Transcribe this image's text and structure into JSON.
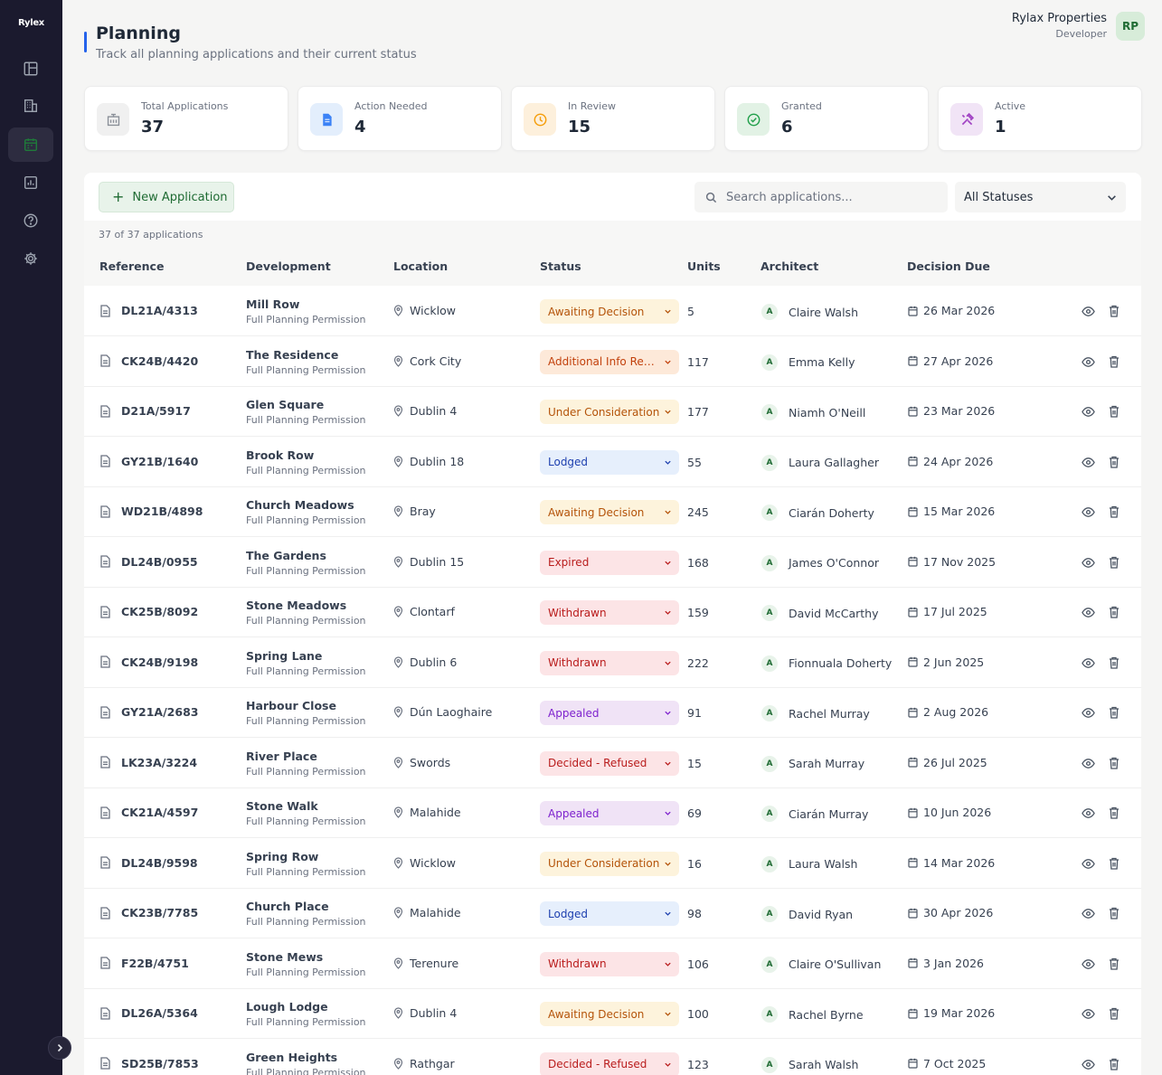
{
  "app": {
    "logo": "Rylex"
  },
  "header": {
    "title": "Planning",
    "subtitle": "Track all planning applications and their current status"
  },
  "user": {
    "name": "Rylax Properties",
    "role": "Developer",
    "initials": "RP"
  },
  "stats": [
    {
      "label": "Total Applications",
      "value": "37",
      "icon": "building-icon",
      "bg": "#f0f0f0",
      "color": "#8a8f98"
    },
    {
      "label": "Action Needed",
      "value": "4",
      "icon": "document-icon",
      "bg": "#e3eefc",
      "color": "#3b82f6"
    },
    {
      "label": "In Review",
      "value": "15",
      "icon": "clock-icon",
      "bg": "#fdf0dc",
      "color": "#f59e0b"
    },
    {
      "label": "Granted",
      "value": "6",
      "icon": "check-circle-icon",
      "bg": "#e2f2e5",
      "color": "#22a04b"
    },
    {
      "label": "Active",
      "value": "1",
      "icon": "tools-icon",
      "bg": "#f1e4f6",
      "color": "#a245c4"
    }
  ],
  "toolbar": {
    "new_label": "New Application",
    "search_placeholder": "Search applications...",
    "status_filter": "All Statuses",
    "count_text": "37 of 37 applications"
  },
  "columns": [
    "Reference",
    "Development",
    "Location",
    "Status",
    "Units",
    "Architect",
    "Decision Due"
  ],
  "status_colors": {
    "Awaiting Decision": {
      "bg": "#fdf3dc",
      "fg": "#b45309"
    },
    "Additional Info Req...": {
      "bg": "#fde9d9",
      "fg": "#c2410c"
    },
    "Under Consideration": {
      "bg": "#fdf3dc",
      "fg": "#b45309"
    },
    "Lodged": {
      "bg": "#e6effc",
      "fg": "#1e40af"
    },
    "Expired": {
      "bg": "#fce4e6",
      "fg": "#b91c1c"
    },
    "Withdrawn": {
      "bg": "#fce4e6",
      "fg": "#b91c1c"
    },
    "Appealed": {
      "bg": "#f0e3f6",
      "fg": "#7e22ce"
    },
    "Decided - Refused": {
      "bg": "#fce4e6",
      "fg": "#b91c1c"
    }
  },
  "rows": [
    {
      "ref": "DL21A/4313",
      "dev": "Mill Row",
      "type": "Full Planning Permission",
      "loc": "Wicklow",
      "status": "Awaiting Decision",
      "units": "5",
      "arch_initial": "A",
      "arch": "Claire Walsh",
      "due": "26 Mar 2026"
    },
    {
      "ref": "CK24B/4420",
      "dev": "The Residence",
      "type": "Full Planning Permission",
      "loc": "Cork City",
      "status": "Additional Info Req...",
      "units": "117",
      "arch_initial": "A",
      "arch": "Emma Kelly",
      "due": "27 Apr 2026"
    },
    {
      "ref": "D21A/5917",
      "dev": "Glen Square",
      "type": "Full Planning Permission",
      "loc": "Dublin 4",
      "status": "Under Consideration",
      "units": "177",
      "arch_initial": "A",
      "arch": "Niamh O'Neill",
      "due": "23 Mar 2026"
    },
    {
      "ref": "GY21B/1640",
      "dev": "Brook Row",
      "type": "Full Planning Permission",
      "loc": "Dublin 18",
      "status": "Lodged",
      "units": "55",
      "arch_initial": "A",
      "arch": "Laura Gallagher",
      "due": "24 Apr 2026"
    },
    {
      "ref": "WD21B/4898",
      "dev": "Church Meadows",
      "type": "Full Planning Permission",
      "loc": "Bray",
      "status": "Awaiting Decision",
      "units": "245",
      "arch_initial": "A",
      "arch": "Ciarán Doherty",
      "due": "15 Mar 2026"
    },
    {
      "ref": "DL24B/0955",
      "dev": "The Gardens",
      "type": "Full Planning Permission",
      "loc": "Dublin 15",
      "status": "Expired",
      "units": "168",
      "arch_initial": "A",
      "arch": "James O'Connor",
      "due": "17 Nov 2025"
    },
    {
      "ref": "CK25B/8092",
      "dev": "Stone Meadows",
      "type": "Full Planning Permission",
      "loc": "Clontarf",
      "status": "Withdrawn",
      "units": "159",
      "arch_initial": "A",
      "arch": "David McCarthy",
      "due": "17 Jul 2025"
    },
    {
      "ref": "CK24B/9198",
      "dev": "Spring Lane",
      "type": "Full Planning Permission",
      "loc": "Dublin 6",
      "status": "Withdrawn",
      "units": "222",
      "arch_initial": "A",
      "arch": "Fionnuala Doherty",
      "due": "2 Jun 2025"
    },
    {
      "ref": "GY21A/2683",
      "dev": "Harbour Close",
      "type": "Full Planning Permission",
      "loc": "Dún Laoghaire",
      "status": "Appealed",
      "units": "91",
      "arch_initial": "A",
      "arch": "Rachel Murray",
      "due": "2 Aug 2026"
    },
    {
      "ref": "LK23A/3224",
      "dev": "River Place",
      "type": "Full Planning Permission",
      "loc": "Swords",
      "status": "Decided - Refused",
      "units": "15",
      "arch_initial": "A",
      "arch": "Sarah Murray",
      "due": "26 Jul 2025"
    },
    {
      "ref": "CK21A/4597",
      "dev": "Stone Walk",
      "type": "Full Planning Permission",
      "loc": "Malahide",
      "status": "Appealed",
      "units": "69",
      "arch_initial": "A",
      "arch": "Ciarán Murray",
      "due": "10 Jun 2026"
    },
    {
      "ref": "DL24B/9598",
      "dev": "Spring Row",
      "type": "Full Planning Permission",
      "loc": "Wicklow",
      "status": "Under Consideration",
      "units": "16",
      "arch_initial": "A",
      "arch": "Laura Walsh",
      "due": "14 Mar 2026"
    },
    {
      "ref": "CK23B/7785",
      "dev": "Church Place",
      "type": "Full Planning Permission",
      "loc": "Malahide",
      "status": "Lodged",
      "units": "98",
      "arch_initial": "A",
      "arch": "David Ryan",
      "due": "30 Apr 2026"
    },
    {
      "ref": "F22B/4751",
      "dev": "Stone Mews",
      "type": "Full Planning Permission",
      "loc": "Terenure",
      "status": "Withdrawn",
      "units": "106",
      "arch_initial": "A",
      "arch": "Claire O'Sullivan",
      "due": "3 Jan 2026"
    },
    {
      "ref": "DL26A/5364",
      "dev": "Lough Lodge",
      "type": "Full Planning Permission",
      "loc": "Dublin 4",
      "status": "Awaiting Decision",
      "units": "100",
      "arch_initial": "A",
      "arch": "Rachel Byrne",
      "due": "19 Mar 2026"
    },
    {
      "ref": "SD25B/7853",
      "dev": "Green Heights",
      "type": "Full Planning Permission",
      "loc": "Rathgar",
      "status": "Decided - Refused",
      "units": "123",
      "arch_initial": "A",
      "arch": "Sarah Walsh",
      "due": "7 Oct 2025"
    }
  ]
}
